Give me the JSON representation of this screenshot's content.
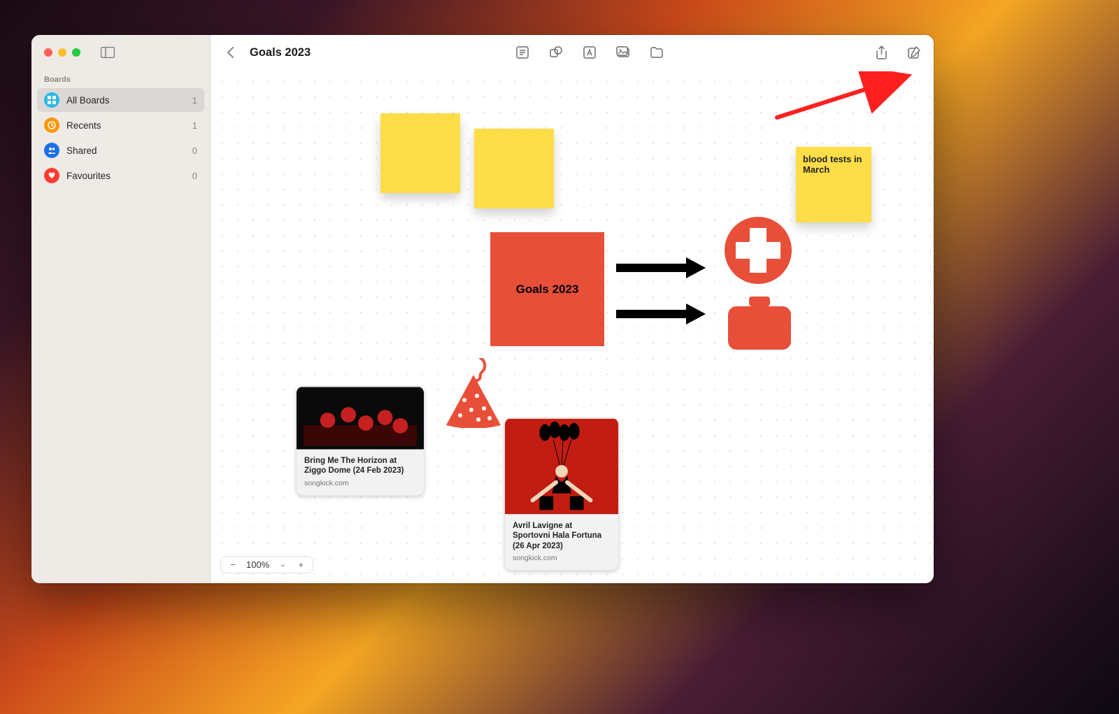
{
  "sidebar": {
    "section_label": "Boards",
    "items": [
      {
        "label": "All Boards",
        "count": "1",
        "icon": "grid-icon",
        "color": "ic-blue",
        "selected": true
      },
      {
        "label": "Recents",
        "count": "1",
        "icon": "clock-icon",
        "color": "ic-orange",
        "selected": false
      },
      {
        "label": "Shared",
        "count": "0",
        "icon": "people-icon",
        "color": "ic-blue2",
        "selected": false
      },
      {
        "label": "Favourites",
        "count": "0",
        "icon": "heart-icon",
        "color": "ic-red",
        "selected": false
      }
    ]
  },
  "header": {
    "board_title": "Goals 2023"
  },
  "canvas": {
    "main_box_label": "Goals 2023",
    "sticky_notes": {
      "note3_text": "blood tests in March"
    },
    "cards": [
      {
        "title": "Bring Me The Horizon at Ziggo Dome (24 Feb 2023)",
        "source": "songkick.com"
      },
      {
        "title": "Avril Lavigne at Sportovni Hala Fortuna (26 Apr 2023)",
        "source": "songkick.com"
      }
    ]
  },
  "zoom": {
    "level": "100%"
  }
}
